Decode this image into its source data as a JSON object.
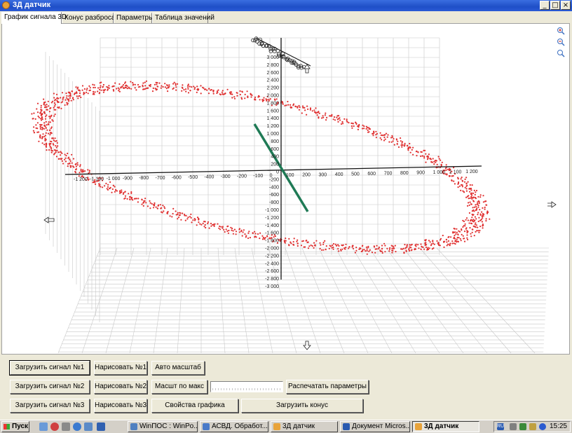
{
  "window": {
    "title": "3Д датчик",
    "controls": {
      "minimize": "_",
      "maximize": "□",
      "close": "×"
    }
  },
  "tabs": [
    {
      "label": "График сигнала 3D",
      "active": true
    },
    {
      "label": "Конус разброса",
      "active": false
    },
    {
      "label": "Параметры",
      "active": false
    },
    {
      "label": "Таблица значений",
      "active": false
    }
  ],
  "plot": {
    "zoom_icons": [
      "zoom-in-icon",
      "zoom-out-icon",
      "zoom-reset-icon"
    ],
    "x_axis_ticks": [
      "-1 200",
      "-1 100",
      "-1 000",
      "-900",
      "-800",
      "-700",
      "-600",
      "-500",
      "-400",
      "-300",
      "-200",
      "-100",
      "0",
      "100",
      "200",
      "300",
      "400",
      "500",
      "600",
      "700",
      "800",
      "900",
      "1 000",
      "1 100",
      "1 200"
    ],
    "y_axis_ticks": [
      "3 000",
      "2 800",
      "2 600",
      "2 400",
      "2 200",
      "2 000",
      "1 800",
      "1 600",
      "1 400",
      "1 200",
      "1 000",
      "800",
      "600",
      "400",
      "200",
      "0",
      "-200",
      "-400",
      "-600",
      "-800",
      "-1 000",
      "-1 200",
      "-1 400",
      "-1 600",
      "-1 800",
      "-2 000",
      "-2 200",
      "-2 400",
      "-2 600",
      "-2 800",
      "-3 000"
    ],
    "point_color": "#e03030",
    "vector_color": "#1f7a55"
  },
  "buttons": {
    "load1": "Загрузить сигнал №1",
    "load2": "Загрузить сигнал №2",
    "load3": "Загрузить сигнал №3",
    "draw1": "Нарисовать №1",
    "draw2": "Нарисовать №2",
    "draw3": "Нарисовать №3",
    "auto_scale": "Авто масштаб",
    "scale_max": "Масшт по макс",
    "print_params": "Распечатать параметры",
    "chart_props": "Свойства графика",
    "load_cone": "Загрузить конус"
  },
  "taskbar": {
    "start": "Пуск",
    "tasks": [
      {
        "label": "WinПОС : WinPo...",
        "active": false
      },
      {
        "label": "АСВД. Обработ...",
        "active": false
      },
      {
        "label": "3Д датчик",
        "active": false
      },
      {
        "label": "Документ Micros...",
        "active": false
      },
      {
        "label": "3Д датчик",
        "active": true
      }
    ],
    "lang": "RU",
    "clock": "15:25"
  }
}
